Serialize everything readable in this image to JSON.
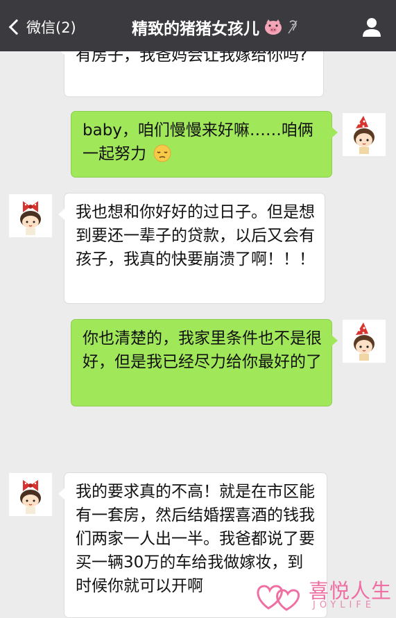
{
  "header": {
    "back_label": "微信(2)",
    "title": "精致的猪猪女孩儿",
    "title_icon": "pig-face-icon",
    "mute_icon": "muted-notification-icon",
    "profile_icon": "person-icon"
  },
  "messages": [
    {
      "sender": "contact",
      "text": "有房子，我爸妈会让我嫁给你吗?"
    },
    {
      "sender": "me",
      "text": "baby，咱们慢慢来好嘛……咱俩一起努力",
      "emoji": "pensive-face-icon"
    },
    {
      "sender": "contact",
      "text": "我也想和你好好的过日子。但是想到要还一辈子的贷款，以后又会有孩子，我真的快要崩溃了啊！！！"
    },
    {
      "sender": "me",
      "text": "你也清楚的，我家里条件也不是很好，但是我已经尽力给你最好的了"
    },
    {
      "sender": "contact",
      "text": "我的要求真的不高！就是在市区能有一套房，然后结婚摆喜酒的钱我们两家一人出一半。我爸都说了要买一辆30万的车给我做嫁妆，到时候你就可以开啊"
    }
  ],
  "watermark": {
    "title": "喜悦人生",
    "subtitle": "JOYLIFE"
  },
  "colors": {
    "header_bg": "#3a3a3f",
    "chat_bg": "#ececec",
    "my_bubble": "#a0e75a",
    "their_bubble": "#ffffff",
    "watermark": "#ef6fa3"
  }
}
